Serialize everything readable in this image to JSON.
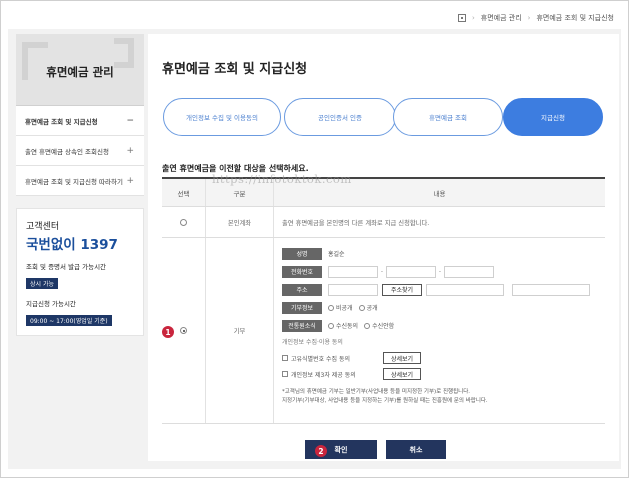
{
  "breadcrumb": {
    "items": [
      "휴면예금 관리",
      "휴면예금 조회 및 지급신청"
    ]
  },
  "sidebar": {
    "title": "휴면예금 관리",
    "items": [
      {
        "label": "휴면예금 조회 및 지급신청",
        "sign": "−"
      },
      {
        "label": "출연 휴면예금 상속인 조회신청",
        "sign": "+"
      },
      {
        "label": "휴면예금 조회 및 지급신청 따라하기",
        "sign": "+"
      }
    ],
    "cs": {
      "title": "고객센터",
      "phone": "국번없이 1397",
      "label1": "조회 및 증명서 발급 가능시간",
      "tag1": "상시 가능",
      "label2": "지급신청 가능시간",
      "tag2": "09:00 ~ 17:00(영업일 기준)"
    }
  },
  "main": {
    "title": "휴면예금 조회 및 지급신청",
    "steps": [
      {
        "label": "개인정보 수집 및 이용동의",
        "active": false
      },
      {
        "label": "공인인증서 인증",
        "active": false
      },
      {
        "label": "휴면예금 조회",
        "active": false
      },
      {
        "label": "지급신청",
        "active": true
      }
    ],
    "instruction": "출연 휴면예금을 이전할 대상을 선택하세요.",
    "watermark": "https://infotoktok.com",
    "table": {
      "headers": [
        "선택",
        "구분",
        "내용"
      ],
      "row1": {
        "category": "본인계좌",
        "content": "출연 휴면예금을 본인명의 다른 계좌로 지급 신청합니다."
      },
      "row2": {
        "category": "기부",
        "name_label": "성명",
        "name_value": "홍길순",
        "phone_label": "전화번호",
        "address_label": "주소",
        "address_button": "주소찾기",
        "donation_label": "기부정보",
        "donation_options": [
          "비공개",
          "공개"
        ],
        "marketing_label": "전통원소식",
        "marketing_options": [
          "수신동의",
          "수신안함"
        ],
        "consent_title": "개인정보 수집·이용 동의",
        "consents": [
          {
            "label": "고유식별번호 수집 동의",
            "button": "상세보기"
          },
          {
            "label": "개인정보 제3자 제공 동의",
            "button": "상세보기"
          }
        ],
        "note1": "*고객님의 휴면예금 기부는 일반기부(사업내용 등을 미지정한 기부)로 진행됩니다.",
        "note2": "지정기부(기부대상, 사업내용 등을 지정하는 기부)를 원하실 때는 진흥원에 문의 바랍니다."
      }
    },
    "buttons": {
      "confirm": "확인",
      "cancel": "취소"
    },
    "badges": [
      "1",
      "2"
    ]
  },
  "colors": {
    "accent": "#3d7de0",
    "navy": "#23355e",
    "badge": "#c9253d",
    "phone": "#1b4f9c"
  }
}
